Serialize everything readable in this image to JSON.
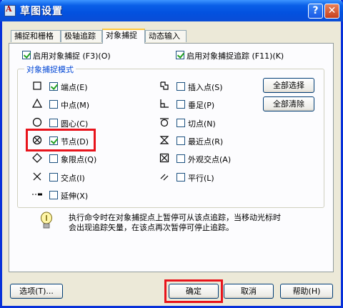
{
  "window": {
    "title": "草图设置",
    "help_label": "?",
    "close_label": "✕"
  },
  "tabs": [
    {
      "label": "捕捉和栅格"
    },
    {
      "label": "极轴追踪"
    },
    {
      "label": "对象捕捉",
      "active": true
    },
    {
      "label": "动态输入"
    }
  ],
  "top_options": {
    "enable_snap": {
      "label": "启用对象捕捉 (F3)(O)",
      "checked": true
    },
    "enable_tracking": {
      "label": "启用对象捕捉追踪 (F11)(K)",
      "checked": true
    }
  },
  "group": {
    "title": "对象捕捉模式",
    "left_modes": [
      {
        "label": "端点(E)",
        "checked": true,
        "icon": "square-endpoint-icon"
      },
      {
        "label": "中点(M)",
        "checked": false,
        "icon": "triangle-midpoint-icon"
      },
      {
        "label": "圆心(C)",
        "checked": false,
        "icon": "circle-center-icon"
      },
      {
        "label": "节点(D)",
        "checked": true,
        "icon": "node-icon"
      },
      {
        "label": "象限点(Q)",
        "checked": false,
        "icon": "diamond-quadrant-icon"
      },
      {
        "label": "交点(I)",
        "checked": false,
        "icon": "x-intersection-icon"
      },
      {
        "label": "延伸(X)",
        "checked": false,
        "icon": "extension-icon"
      }
    ],
    "right_modes": [
      {
        "label": "插入点(S)",
        "checked": false,
        "icon": "insertion-icon"
      },
      {
        "label": "垂足(P)",
        "checked": false,
        "icon": "perpendicular-icon"
      },
      {
        "label": "切点(N)",
        "checked": false,
        "icon": "tangent-icon"
      },
      {
        "label": "最近点(R)",
        "checked": false,
        "icon": "nearest-icon"
      },
      {
        "label": "外观交点(A)",
        "checked": false,
        "icon": "apparent-intersection-icon"
      },
      {
        "label": "平行(L)",
        "checked": false,
        "icon": "parallel-icon"
      }
    ],
    "select_all_label": "全部选择",
    "clear_all_label": "全部清除"
  },
  "info": {
    "line1": "执行命令时在对象捕捉点上暂停可从该点追踪，当移动光标时",
    "line2": "会出现追踪矢量，在该点再次暂停可停止追踪。"
  },
  "footer": {
    "options_label": "选项(T)...",
    "ok_label": "确定",
    "cancel_label": "取消",
    "help_label": "帮助(H)"
  },
  "colors": {
    "title_blue": "#0a5fe8",
    "group_title": "#0046d5",
    "highlight_red": "#e8141c",
    "check_green": "#21a121"
  }
}
